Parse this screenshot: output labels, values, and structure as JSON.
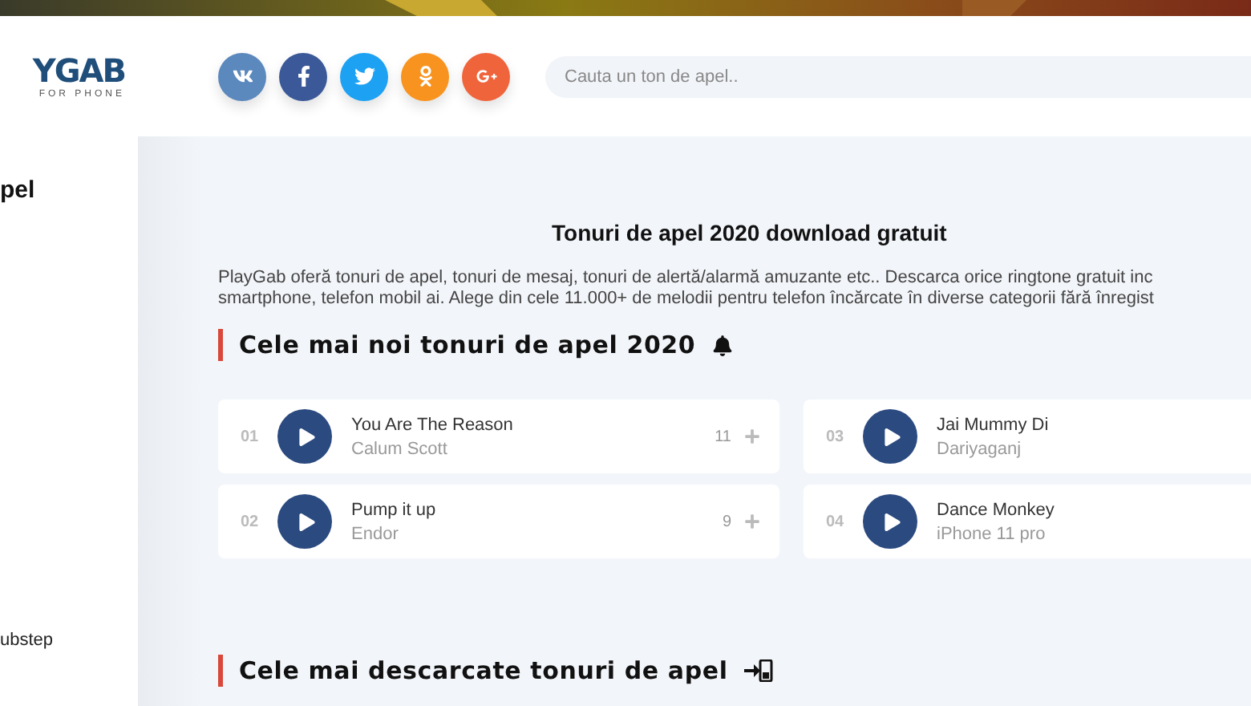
{
  "logo": {
    "name": "YGAB",
    "tagline": "FOR PHONE"
  },
  "social": [
    {
      "kind": "vk",
      "color": "#5b88bd"
    },
    {
      "kind": "facebook",
      "color": "#3b5998"
    },
    {
      "kind": "twitter",
      "color": "#1da1f2"
    },
    {
      "kind": "odnoklassniki",
      "color": "#f7931e"
    },
    {
      "kind": "googleplus",
      "color": "#f0643c"
    }
  ],
  "search": {
    "placeholder": "Cauta un ton de apel.."
  },
  "sidebar": {
    "heading": "pel",
    "items": [
      "ubstep"
    ]
  },
  "main": {
    "title": "Tonuri de apel 2020 download gratuit",
    "intro": [
      "PlayGab oferă tonuri de apel, tonuri de mesaj, tonuri de alertă/alarmă amuzante etc.. Descarca orice ringtone gratuit inc",
      "smartphone, telefon mobil ai. Alege din cele 11.000+ de melodii pentru telefon încărcate în diverse categorii fără înregist"
    ],
    "sections": [
      {
        "heading": "Cele mai noi tonuri de apel 2020",
        "kind": "bell",
        "tracks": [
          {
            "number": "01",
            "title": "You Are The Reason",
            "artist": "Calum Scott",
            "count": "11"
          },
          {
            "number": "03",
            "title": "Jai Mummy Di",
            "artist": "Dariyaganj"
          },
          {
            "number": "02",
            "title": "Pump it up",
            "artist": "Endor",
            "count": "9"
          },
          {
            "number": "04",
            "title": "Dance Monkey",
            "artist": "iPhone 11 pro"
          }
        ]
      },
      {
        "heading": "Cele mai descarcate tonuri de apel",
        "kind": "download"
      }
    ]
  }
}
